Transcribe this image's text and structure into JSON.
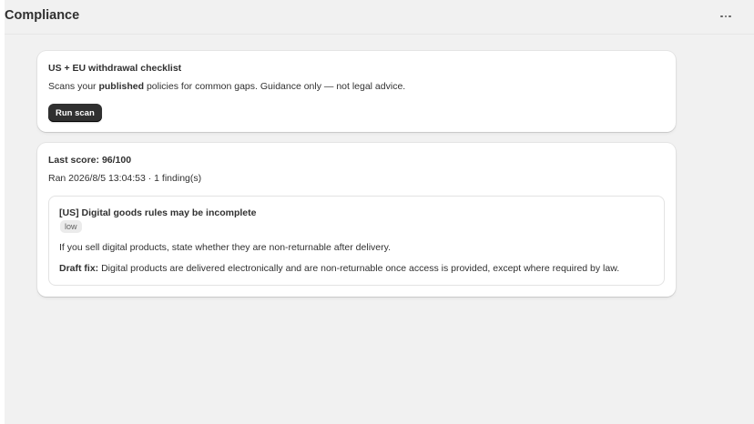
{
  "page": {
    "title": "Compliance",
    "more_icon": "more-horizontal-icon"
  },
  "checklist": {
    "heading": "US + EU withdrawal checklist",
    "desc_prefix": "Scans your ",
    "desc_bold": "published",
    "desc_suffix": " policies for common gaps. Guidance only — not legal advice.",
    "run_button": "Run scan"
  },
  "results": {
    "score": "Last score: 96/100",
    "ran": "Ran 2026/8/5 13:04:53 · 1 finding(s)",
    "findings": [
      {
        "title": "[US] Digital goods rules may be incomplete",
        "severity": "low",
        "description": "If you sell digital products, state whether they are non-returnable after delivery.",
        "fix_label": "Draft fix:",
        "fix_text": " Digital products are delivered electronically and are non-returnable once access is provided, except where required by law."
      }
    ]
  },
  "colors": {
    "background": "#f1f1f1",
    "card": "#ffffff",
    "primary_button": "#303030",
    "badge": "#ebebeb"
  }
}
